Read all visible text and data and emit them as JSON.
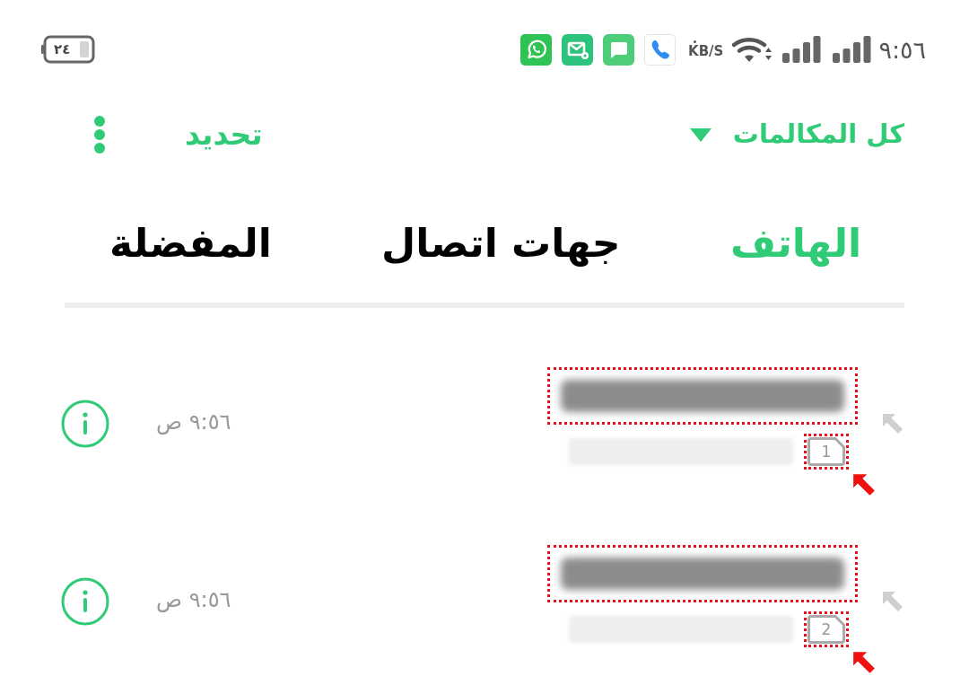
{
  "status_bar": {
    "time": "٩:٥٦",
    "network_speed": "KB/S",
    "battery": "٢٤"
  },
  "toolbar": {
    "filter": "كل المكالمات",
    "select": "تحديد"
  },
  "tabs": [
    {
      "label": "الهاتف",
      "selected": true
    },
    {
      "label": "جهات اتصال",
      "selected": false
    },
    {
      "label": "المفضلة",
      "selected": false
    }
  ],
  "calls": [
    {
      "sim": "1",
      "time": "٩:٥٦ ص",
      "outgoing": true,
      "marked": true
    },
    {
      "sim": "2",
      "time": "٩:٥٦ ص",
      "outgoing": true,
      "marked": true
    }
  ]
}
